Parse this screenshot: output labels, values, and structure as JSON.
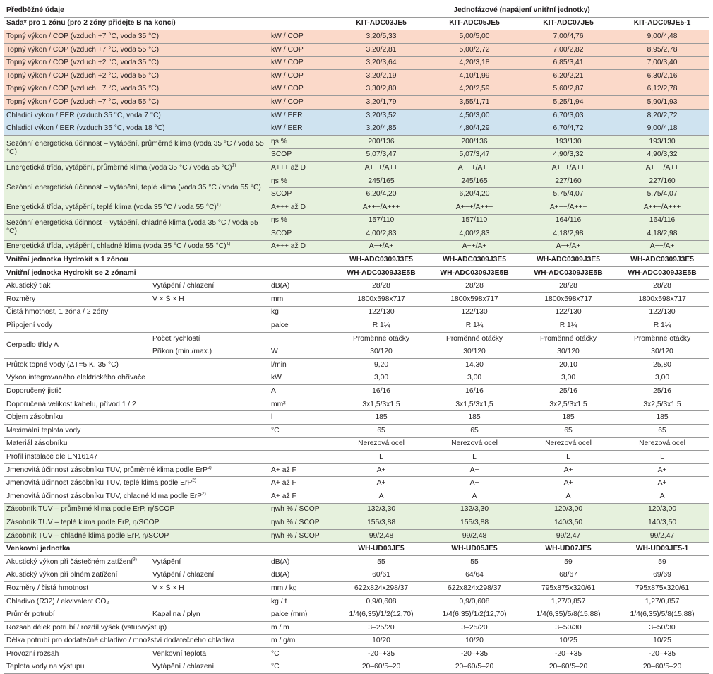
{
  "header": {
    "title": "Předběžné údaje",
    "group_label": "Jednofázové (napájení vnitřní jednotky)"
  },
  "models_row": {
    "label": "Sada* pro 1 zónu (pro 2 zóny přidejte B na konci)",
    "values": [
      "KIT-ADC03JE5",
      "KIT-ADC05JE5",
      "KIT-ADC07JE5",
      "KIT-ADC09JE5-1"
    ]
  },
  "performance_rows": [
    {
      "label": "Topný výkon / COP (vzduch +7 °C, voda 35 °C)",
      "unit": "kW / COP",
      "values": [
        "3,20/5,33",
        "5,00/5,00",
        "7,00/4,76",
        "9,00/4,48"
      ],
      "band": "orange"
    },
    {
      "label": "Topný výkon / COP (vzduch +7 °C, voda 55 °C)",
      "unit": "kW / COP",
      "values": [
        "3,20/2,81",
        "5,00/2,72",
        "7,00/2,82",
        "8,95/2,78"
      ],
      "band": "orange"
    },
    {
      "label": "Topný výkon / COP (vzduch +2 °C, voda 35 °C)",
      "unit": "kW / COP",
      "values": [
        "3,20/3,64",
        "4,20/3,18",
        "6,85/3,41",
        "7,00/3,40"
      ],
      "band": "orange"
    },
    {
      "label": "Topný výkon / COP (vzduch +2 °C, voda 55 °C)",
      "unit": "kW / COP",
      "values": [
        "3,20/2,19",
        "4,10/1,99",
        "6,20/2,21",
        "6,30/2,16"
      ],
      "band": "orange"
    },
    {
      "label": "Topný výkon / COP (vzduch −7 °C, voda 35 °C)",
      "unit": "kW / COP",
      "values": [
        "3,30/2,80",
        "4,20/2,59",
        "5,60/2,87",
        "6,12/2,78"
      ],
      "band": "orange"
    },
    {
      "label": "Topný výkon / COP (vzduch −7 °C, voda 55 °C)",
      "unit": "kW / COP",
      "values": [
        "3,20/1,79",
        "3,55/1,71",
        "5,25/1,94",
        "5,90/1,93"
      ],
      "band": "orange"
    },
    {
      "label": "Chladicí výkon / EER (vzduch 35 °C, voda 7 °C)",
      "unit": "kW / EER",
      "values": [
        "3,20/3,52",
        "4,50/3,00",
        "6,70/3,03",
        "8,20/2,72"
      ],
      "band": "blue"
    },
    {
      "label": "Chladicí výkon / EER (vzduch 35 °C, voda 18 °C)",
      "unit": "kW / EER",
      "values": [
        "3,20/4,85",
        "4,80/4,29",
        "6,70/4,72",
        "9,00/4,18"
      ],
      "band": "blue"
    }
  ],
  "seasonal_blocks": [
    {
      "label": "Sezónní energetická účinnost – vytápění, průměrné klima (voda 35 °C / voda 55 °C)",
      "rows": [
        {
          "unit": "ηs %",
          "values": [
            "200/136",
            "200/136",
            "193/130",
            "193/130"
          ]
        },
        {
          "unit": "SCOP",
          "values": [
            "5,07/3,47",
            "5,07/3,47",
            "4,90/3,32",
            "4,90/3,32"
          ]
        }
      ]
    },
    {
      "energy_label": "Energetická třída, vytápění, průměrné klima (voda 35 °C / voda 55 °C)",
      "energy_unit": "A+++ až D",
      "energy_values": [
        "A+++/A++",
        "A+++/A++",
        "A+++/A++",
        "A+++/A++"
      ]
    },
    {
      "label": "Sezónní energetická účinnost – vytápění, teplé klima (voda 35 °C / voda 55 °C)",
      "rows": [
        {
          "unit": "ηs %",
          "values": [
            "245/165",
            "245/165",
            "227/160",
            "227/160"
          ]
        },
        {
          "unit": "SCOP",
          "values": [
            "6,20/4,20",
            "6,20/4,20",
            "5,75/4,07",
            "5,75/4,07"
          ]
        }
      ]
    },
    {
      "energy_label": "Energetická třída, vytápění, teplé klima (voda 35 °C / voda 55 °C)",
      "energy_unit": "A+++ až D",
      "energy_values": [
        "A+++/A+++",
        "A+++/A+++",
        "A+++/A+++",
        "A+++/A+++"
      ]
    },
    {
      "label": "Sezónní energetická účinnost – vytápění, chladné klima (voda 35 °C / voda 55 °C)",
      "rows": [
        {
          "unit": "ηs %",
          "values": [
            "157/110",
            "157/110",
            "164/116",
            "164/116"
          ]
        },
        {
          "unit": "SCOP",
          "values": [
            "4,00/2,83",
            "4,00/2,83",
            "4,18/2,98",
            "4,18/2,98"
          ]
        }
      ]
    },
    {
      "energy_label": "Energetická třída, vytápění, chladné klima (voda 35 °C / voda 55 °C)",
      "energy_unit": "A+++ až D",
      "energy_values": [
        "A++/A+",
        "A++/A+",
        "A++/A+",
        "A++/A+"
      ]
    }
  ],
  "footnote_marks": {
    "one": "1)",
    "two": "2)",
    "three": "3)"
  },
  "indoor": {
    "title_1zone": "Vnitřní jednotka Hydrokit s 1 zónou",
    "models_1zone": [
      "WH-ADC0309J3E5",
      "WH-ADC0309J3E5",
      "WH-ADC0309J3E5",
      "WH-ADC0309J3E5"
    ],
    "title_2zone": "Vnitřní jednotka Hydrokit se 2 zónami",
    "models_2zone": [
      "WH-ADC0309J3E5B",
      "WH-ADC0309J3E5B",
      "WH-ADC0309J3E5B",
      "WH-ADC0309J3E5B"
    ],
    "rows": [
      {
        "label": "Akustický tlak",
        "sub": "Vytápění / chlazení",
        "unit": "dB(A)",
        "values": [
          "28/28",
          "28/28",
          "28/28",
          "28/28"
        ]
      },
      {
        "label": "Rozměry",
        "sub": "V × Š × H",
        "unit": "mm",
        "values": [
          "1800x598x717",
          "1800x598x717",
          "1800x598x717",
          "1800x598x717"
        ]
      },
      {
        "label": "Čistá hmotnost, 1 zóna / 2 zóny",
        "sub": "",
        "unit": "kg",
        "values": [
          "122/130",
          "122/130",
          "122/130",
          "122/130"
        ]
      },
      {
        "label": "Připojení vody",
        "sub": "",
        "unit": "palce",
        "values": [
          "R 1¼",
          "R 1¼",
          "R 1¼",
          "R 1¼"
        ]
      }
    ],
    "pump": {
      "label": "Čerpadlo třídy A",
      "sub1": "Počet rychlostí",
      "values1": [
        "Proměnné otáčky",
        "Proměnné otáčky",
        "Proměnné otáčky",
        "Proměnné otáčky"
      ],
      "sub2": "Příkon (min./max.)",
      "unit2": "W",
      "values2": [
        "30/120",
        "30/120",
        "30/120",
        "30/120"
      ]
    },
    "rows2": [
      {
        "label": "Průtok topné vody (ΔT=5 K. 35 °C)",
        "sub": "",
        "unit": "l/min",
        "values": [
          "9,20",
          "14,30",
          "20,10",
          "25,80"
        ]
      },
      {
        "label": "Výkon integrovaného elektrického ohřívače",
        "sub": "",
        "unit": "kW",
        "values": [
          "3,00",
          "3,00",
          "3,00",
          "3,00"
        ]
      },
      {
        "label": "Doporučený jistič",
        "sub": "",
        "unit": "A",
        "values": [
          "16/16",
          "16/16",
          "25/16",
          "25/16"
        ]
      },
      {
        "label": "Doporučená velikost kabelu, přívod 1 / 2",
        "sub": "",
        "unit": "mm²",
        "values": [
          "3x1,5/3x1,5",
          "3x1,5/3x1,5",
          "3x2,5/3x1,5",
          "3x2,5/3x1,5"
        ]
      },
      {
        "label": "Objem zásobníku",
        "sub": "",
        "unit": "l",
        "values": [
          "185",
          "185",
          "185",
          "185"
        ]
      },
      {
        "label": "Maximální teplota vody",
        "sub": "",
        "unit": "°C",
        "values": [
          "65",
          "65",
          "65",
          "65"
        ]
      },
      {
        "label": "Materiál zásobníku",
        "sub": "",
        "unit": "",
        "values": [
          "Nerezová ocel",
          "Nerezová ocel",
          "Nerezová ocel",
          "Nerezová ocel"
        ]
      },
      {
        "label": "Profil instalace dle EN16147",
        "sub": "",
        "unit": "",
        "values": [
          "L",
          "L",
          "L",
          "L"
        ]
      }
    ],
    "erp_rows": [
      {
        "label": "Jmenovitá účinnost zásobníku TUV, průměrné klima podle ErP",
        "unit": "A+ až F",
        "values": [
          "A+",
          "A+",
          "A+",
          "A+"
        ]
      },
      {
        "label": "Jmenovitá účinnost zásobníku TUV, teplé klima podle ErP",
        "unit": "A+ až F",
        "values": [
          "A+",
          "A+",
          "A+",
          "A+"
        ]
      },
      {
        "label": "Jmenovitá účinnost zásobníku TUV, chladné klima podle ErP",
        "unit": "A+ až F",
        "values": [
          "A",
          "A",
          "A",
          "A"
        ]
      }
    ],
    "tuv_rows": [
      {
        "label": "Zásobník TUV – průměrné klima podle ErP, η/SCOP",
        "unit": "ηwh % / SCOP",
        "values": [
          "132/3,30",
          "132/3,30",
          "120/3,00",
          "120/3,00"
        ]
      },
      {
        "label": "Zásobník TUV – teplé klima podle ErP, η/SCOP",
        "unit": "ηwh % / SCOP",
        "values": [
          "155/3,88",
          "155/3,88",
          "140/3,50",
          "140/3,50"
        ]
      },
      {
        "label": "Zásobník TUV – chladné klima podle ErP, η/SCOP",
        "unit": "ηwh % / SCOP",
        "values": [
          "99/2,48",
          "99/2,48",
          "99/2,47",
          "99/2,47"
        ]
      }
    ]
  },
  "outdoor": {
    "title": "Venkovní jednotka",
    "models": [
      "WH-UD03JE5",
      "WH-UD05JE5",
      "WH-UD07JE5",
      "WH-UD09JE5-1"
    ],
    "rows": [
      {
        "label": "Akustický výkon při částečném zatížení",
        "mark": "3)",
        "sub": "Vytápění",
        "unit": "dB(A)",
        "values": [
          "55",
          "55",
          "59",
          "59"
        ]
      },
      {
        "label": "Akustický výkon při plném zatížení",
        "mark": "",
        "sub": "Vytápění / chlazení",
        "unit": "dB(A)",
        "values": [
          "60/61",
          "64/64",
          "68/67",
          "69/69"
        ]
      },
      {
        "label": "Rozměry / čistá hmotnost",
        "mark": "",
        "sub": "V × Š × H",
        "unit": "mm / kg",
        "values": [
          "622x824x298/37",
          "622x824x298/37",
          "795x875x320/61",
          "795x875x320/61"
        ]
      },
      {
        "label": "Chladivo (R32) / ekvivalent CO₂",
        "mark": "",
        "sub": "",
        "unit": "kg / t",
        "values": [
          "0,9/0,608",
          "0,9/0,608",
          "1,27/0,857",
          "1,27/0,857"
        ]
      },
      {
        "label": "Průměr potrubí",
        "mark": "",
        "sub": "Kapalina / plyn",
        "unit": "palce (mm)",
        "values": [
          "1/4(6,35)/1/2(12,70)",
          "1/4(6,35)/1/2(12,70)",
          "1/4(6,35)/5/8(15,88)",
          "1/4(6,35)/5/8(15,88)"
        ]
      },
      {
        "label": "Rozsah délek potrubí / rozdíl výšek (vstup/výstup)",
        "mark": "",
        "sub": "",
        "unit": "m / m",
        "values": [
          "3–25/20",
          "3–25/20",
          "3–50/30",
          "3–50/30"
        ]
      },
      {
        "label": "Délka potrubí pro dodatečné chladivo / množství dodatečného chladiva",
        "mark": "",
        "sub": "",
        "unit": "m / g/m",
        "values": [
          "10/20",
          "10/20",
          "10/25",
          "10/25"
        ]
      },
      {
        "label": "Provozní rozsah",
        "mark": "",
        "sub": "Venkovní teplota",
        "unit": "°C",
        "values": [
          "-20–+35",
          "-20–+35",
          "-20–+35",
          "-20–+35"
        ]
      },
      {
        "label": "Teplota vody na výstupu",
        "mark": "",
        "sub": "Vytápění / chlazení",
        "unit": "°C",
        "values": [
          "20–60/5–20",
          "20–60/5–20",
          "20–60/5–20",
          "20–60/5–20"
        ]
      }
    ]
  }
}
